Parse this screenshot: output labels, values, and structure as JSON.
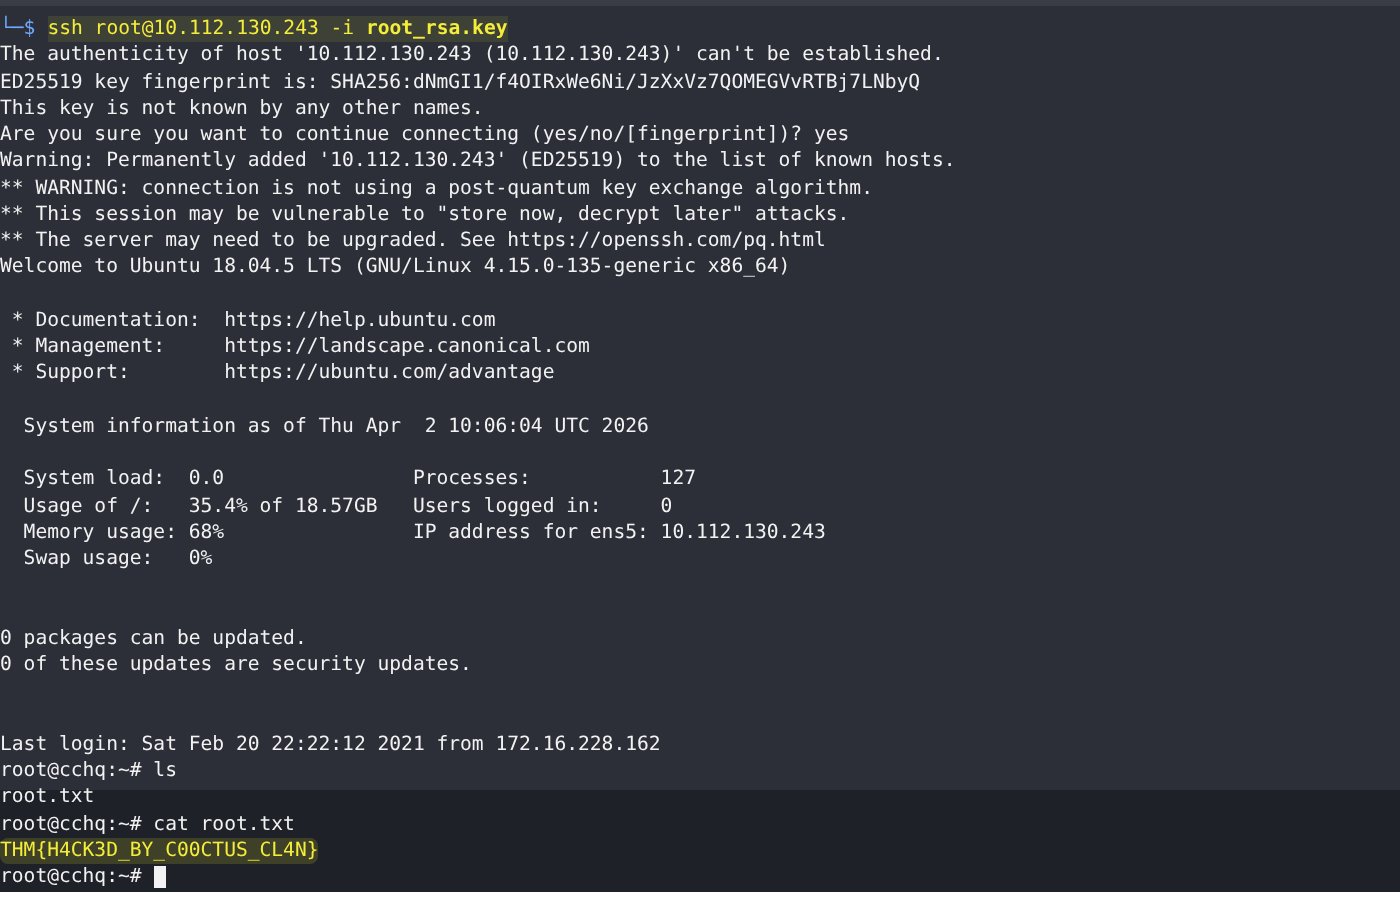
{
  "terminal": {
    "lines": [
      {
        "kind": "command",
        "prompt": "└─$",
        "text": "ssh root@10.112.130.243 -i **root_rsa.key**"
      },
      {
        "kind": "output",
        "text": "The authenticity of host '10.112.130.243 (10.112.130.243)' can't be established."
      },
      {
        "kind": "output",
        "text": "ED25519 key fingerprint is: SHA256:dNmGI1/f4OIRxWe6Ni/JzXxVz7QOMEGVvRTBj7LNbyQ"
      },
      {
        "kind": "output",
        "text": "This key is not known by any other names."
      },
      {
        "kind": "output",
        "text": "Are you sure you want to continue connecting (yes/no/[fingerprint])? yes"
      },
      {
        "kind": "output",
        "text": "Warning: Permanently added '10.112.130.243' (ED25519) to the list of known hosts."
      },
      {
        "kind": "output",
        "text": "** WARNING: connection is not using a post-quantum key exchange algorithm."
      },
      {
        "kind": "output",
        "text": "** This session may be vulnerable to \"store now, decrypt later\" attacks."
      },
      {
        "kind": "output",
        "text": "** The server may need to be upgraded. See https://openssh.com/pq.html"
      },
      {
        "kind": "output",
        "text": "Welcome to Ubuntu 18.04.5 LTS (GNU/Linux 4.15.0-135-generic x86_64)"
      },
      {
        "kind": "blank"
      },
      {
        "kind": "output",
        "text": " * Documentation:  https://help.ubuntu.com"
      },
      {
        "kind": "output",
        "text": " * Management:     https://landscape.canonical.com"
      },
      {
        "kind": "output",
        "text": " * Support:        https://ubuntu.com/advantage"
      },
      {
        "kind": "blank"
      },
      {
        "kind": "output",
        "text": "  System information as of Thu Apr  2 10:06:04 UTC 2026"
      },
      {
        "kind": "blank"
      },
      {
        "kind": "output",
        "text": "  System load:  0.0                Processes:           127"
      },
      {
        "kind": "output",
        "text": "  Usage of /:   35.4% of 18.57GB   Users logged in:     0"
      },
      {
        "kind": "output",
        "text": "  Memory usage: 68%                IP address for ens5: 10.112.130.243"
      },
      {
        "kind": "output",
        "text": "  Swap usage:   0%"
      },
      {
        "kind": "blank"
      },
      {
        "kind": "blank"
      },
      {
        "kind": "output",
        "text": "0 packages can be updated."
      },
      {
        "kind": "output",
        "text": "0 of these updates are security updates."
      },
      {
        "kind": "blank"
      },
      {
        "kind": "blank"
      },
      {
        "kind": "output",
        "text": "Last login: Sat Feb 20 22:22:12 2021 from 172.16.228.162"
      },
      {
        "kind": "output",
        "text": "root@cchq:~# ls"
      },
      {
        "kind": "output",
        "text": "root.txt"
      },
      {
        "kind": "output",
        "text": "root@cchq:~# cat root.txt"
      },
      {
        "kind": "flag",
        "text": "THM{H4CK3D_BY_C00CTUS_CL4N}"
      },
      {
        "kind": "input",
        "text": "root@cchq:~#",
        "cursor": true
      }
    ]
  }
}
